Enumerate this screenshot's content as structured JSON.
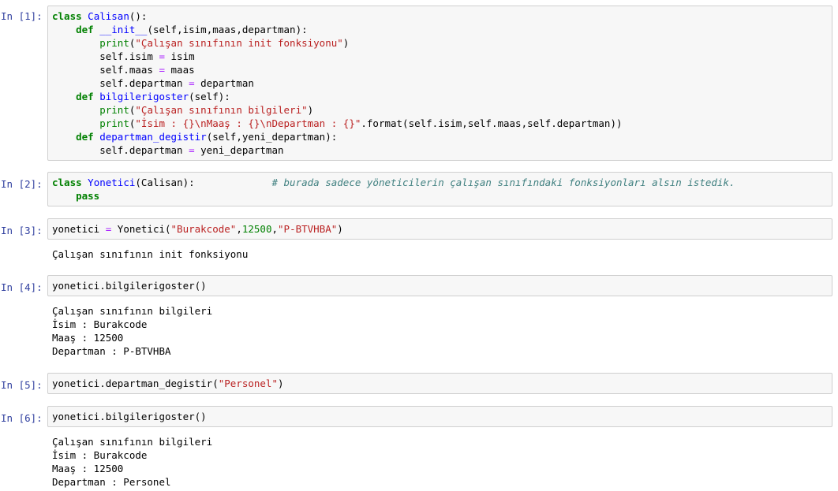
{
  "cells": [
    {
      "prompt": "In [1]:",
      "code": [
        [
          [
            "kw",
            "class"
          ],
          [
            "p",
            " "
          ],
          [
            "cls",
            "Calisan"
          ],
          [
            "p",
            "():"
          ]
        ],
        [
          [
            "p",
            "    "
          ],
          [
            "kw",
            "def"
          ],
          [
            "p",
            " "
          ],
          [
            "fn",
            "__init__"
          ],
          [
            "p",
            "(self,isim,maas,departman):"
          ]
        ],
        [
          [
            "p",
            "        "
          ],
          [
            "bi",
            "print"
          ],
          [
            "p",
            "("
          ],
          [
            "str",
            "\"Çalışan sınıfının init fonksiyonu\""
          ],
          [
            "p",
            ")"
          ]
        ],
        [
          [
            "p",
            "        self.isim "
          ],
          [
            "op",
            "="
          ],
          [
            "p",
            " isim"
          ]
        ],
        [
          [
            "p",
            "        self.maas "
          ],
          [
            "op",
            "="
          ],
          [
            "p",
            " maas"
          ]
        ],
        [
          [
            "p",
            "        self.departman "
          ],
          [
            "op",
            "="
          ],
          [
            "p",
            " departman"
          ]
        ],
        [
          [
            "p",
            "    "
          ],
          [
            "kw",
            "def"
          ],
          [
            "p",
            " "
          ],
          [
            "fn",
            "bilgilerigoster"
          ],
          [
            "p",
            "(self):"
          ]
        ],
        [
          [
            "p",
            "        "
          ],
          [
            "bi",
            "print"
          ],
          [
            "p",
            "("
          ],
          [
            "str",
            "\"Çalışan sınıfının bilgileri\""
          ],
          [
            "p",
            ")"
          ]
        ],
        [
          [
            "p",
            "        "
          ],
          [
            "bi",
            "print"
          ],
          [
            "p",
            "("
          ],
          [
            "str",
            "\"İsim : {}\\nMaaş : {}\\nDepartman : {}\""
          ],
          [
            "p",
            ".format(self.isim,self.maas,self.departman))"
          ]
        ],
        [
          [
            "p",
            "    "
          ],
          [
            "kw",
            "def"
          ],
          [
            "p",
            " "
          ],
          [
            "fn",
            "departman_degistir"
          ],
          [
            "p",
            "(self,yeni_departman):"
          ]
        ],
        [
          [
            "p",
            "        self.departman "
          ],
          [
            "op",
            "="
          ],
          [
            "p",
            " yeni_departman"
          ]
        ]
      ],
      "output": []
    },
    {
      "prompt": "In [2]:",
      "code": [
        [
          [
            "kw",
            "class"
          ],
          [
            "p",
            " "
          ],
          [
            "cls",
            "Yonetici"
          ],
          [
            "p",
            "(Calisan):             "
          ],
          [
            "cm",
            "# burada sadece yöneticilerin çalışan sınıfındaki fonksiyonları alsın istedik."
          ]
        ],
        [
          [
            "p",
            "    "
          ],
          [
            "kw",
            "pass"
          ]
        ]
      ],
      "output": []
    },
    {
      "prompt": "In [3]:",
      "code": [
        [
          [
            "p",
            "yonetici "
          ],
          [
            "op",
            "="
          ],
          [
            "p",
            " Yonetici("
          ],
          [
            "str",
            "\"Burakcode\""
          ],
          [
            "p",
            ","
          ],
          [
            "num",
            "12500"
          ],
          [
            "p",
            ","
          ],
          [
            "str",
            "\"P-BTVHBA\""
          ],
          [
            "p",
            ")"
          ]
        ]
      ],
      "output": [
        "Çalışan sınıfının init fonksiyonu"
      ]
    },
    {
      "prompt": "In [4]:",
      "code": [
        [
          [
            "p",
            "yonetici.bilgilerigoster()"
          ]
        ]
      ],
      "output": [
        "Çalışan sınıfının bilgileri",
        "İsim : Burakcode",
        "Maaş : 12500",
        "Departman : P-BTVHBA"
      ]
    },
    {
      "prompt": "In [5]:",
      "code": [
        [
          [
            "p",
            "yonetici.departman_degistir("
          ],
          [
            "str",
            "\"Personel\""
          ],
          [
            "p",
            ")"
          ]
        ]
      ],
      "output": []
    },
    {
      "prompt": "In [6]:",
      "code": [
        [
          [
            "p",
            "yonetici.bilgilerigoster()"
          ]
        ]
      ],
      "output": [
        "Çalışan sınıfının bilgileri",
        "İsim : Burakcode",
        "Maaş : 12500",
        "Departman : Personel"
      ]
    }
  ]
}
